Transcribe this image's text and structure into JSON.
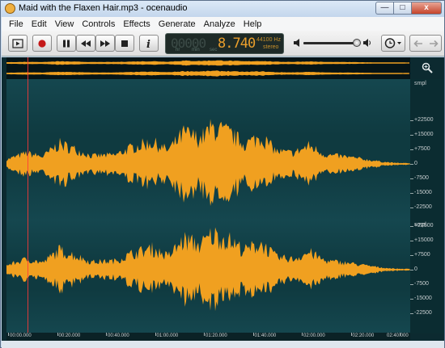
{
  "window": {
    "title": "Maid with the Flaxen Hair.mp3 - ocenaudio",
    "buttons": [
      "—",
      "□",
      "x"
    ]
  },
  "menu": [
    "File",
    "Edit",
    "View",
    "Controls",
    "Effects",
    "Generate",
    "Analyze",
    "Help"
  ],
  "toolbar": {
    "display": {
      "ghost_digits": "00000",
      "time": "8.740",
      "units": [
        "hr",
        "min",
        "sec"
      ],
      "sample_rate": "44100 Hz",
      "channels": "stereo"
    }
  },
  "editor": {
    "scale_unit": "smpl",
    "scale_ticks": [
      "+22500",
      "+15000",
      "+7500",
      "0",
      "-7500",
      "-15000",
      "-22500"
    ],
    "time_ticks": [
      "00:00.000",
      "00:20.000",
      "00:40.000",
      "01:00.000",
      "01:20.000",
      "01:40.000",
      "02:00.000",
      "02:20.000",
      "02:40.000"
    ],
    "waveform_color": "#f0a020",
    "background_color": "#0f3a40",
    "cursor_color": "#ff3a3a"
  }
}
